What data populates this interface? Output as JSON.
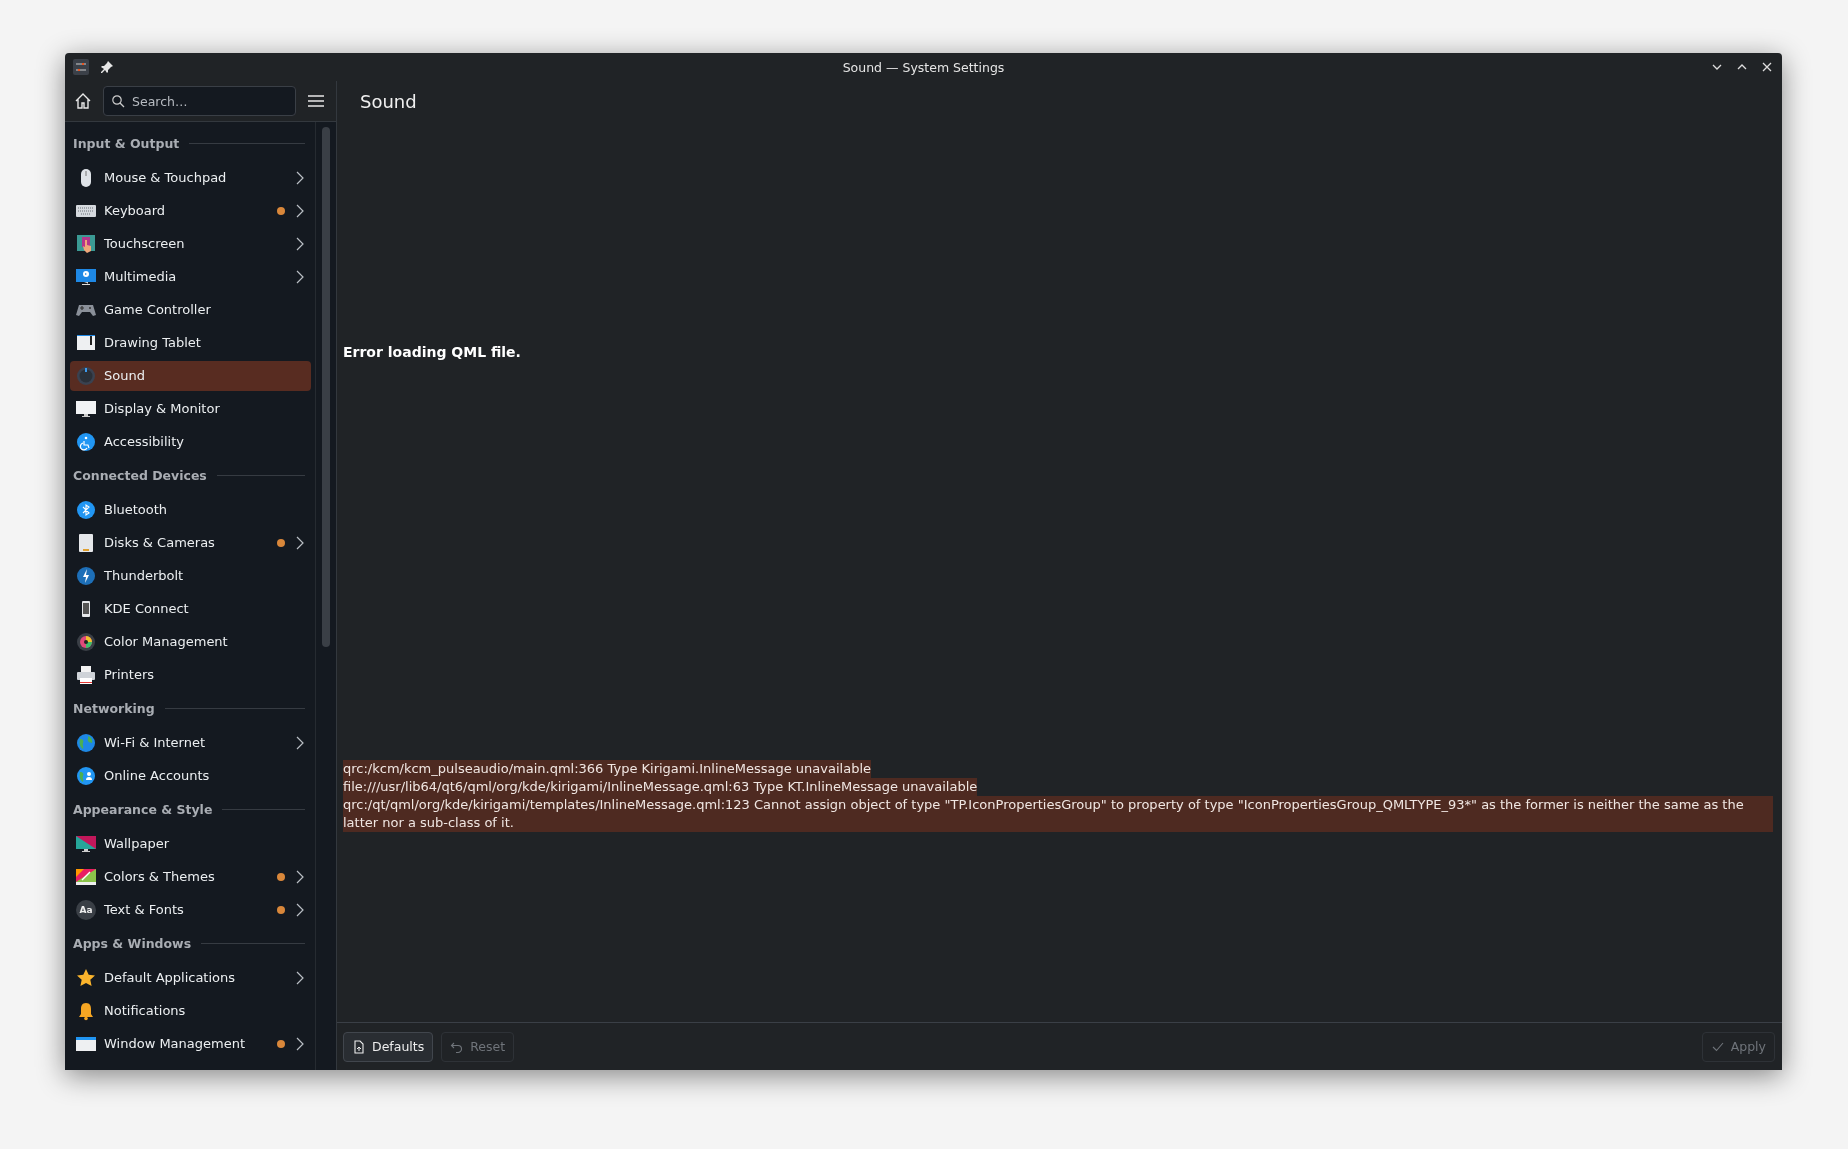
{
  "window": {
    "title": "Sound — System Settings"
  },
  "search": {
    "placeholder": "Search…"
  },
  "sidebar": {
    "sections": [
      {
        "title": "Input & Output",
        "items": [
          {
            "label": "Mouse & Touchpad",
            "modified": false,
            "has_children": true,
            "selected": false
          },
          {
            "label": "Keyboard",
            "modified": true,
            "has_children": true,
            "selected": false
          },
          {
            "label": "Touchscreen",
            "modified": false,
            "has_children": true,
            "selected": false
          },
          {
            "label": "Multimedia",
            "modified": false,
            "has_children": true,
            "selected": false
          },
          {
            "label": "Game Controller",
            "modified": false,
            "has_children": false,
            "selected": false
          },
          {
            "label": "Drawing Tablet",
            "modified": false,
            "has_children": false,
            "selected": false
          },
          {
            "label": "Sound",
            "modified": false,
            "has_children": false,
            "selected": true
          },
          {
            "label": "Display & Monitor",
            "modified": false,
            "has_children": false,
            "selected": false
          },
          {
            "label": "Accessibility",
            "modified": false,
            "has_children": false,
            "selected": false
          }
        ]
      },
      {
        "title": "Connected Devices",
        "items": [
          {
            "label": "Bluetooth",
            "modified": false,
            "has_children": false,
            "selected": false
          },
          {
            "label": "Disks & Cameras",
            "modified": true,
            "has_children": true,
            "selected": false
          },
          {
            "label": "Thunderbolt",
            "modified": false,
            "has_children": false,
            "selected": false
          },
          {
            "label": "KDE Connect",
            "modified": false,
            "has_children": false,
            "selected": false
          },
          {
            "label": "Color Management",
            "modified": false,
            "has_children": false,
            "selected": false
          },
          {
            "label": "Printers",
            "modified": false,
            "has_children": false,
            "selected": false
          }
        ]
      },
      {
        "title": "Networking",
        "items": [
          {
            "label": "Wi-Fi & Internet",
            "modified": false,
            "has_children": true,
            "selected": false
          },
          {
            "label": "Online Accounts",
            "modified": false,
            "has_children": false,
            "selected": false
          }
        ]
      },
      {
        "title": "Appearance & Style",
        "items": [
          {
            "label": "Wallpaper",
            "modified": false,
            "has_children": false,
            "selected": false
          },
          {
            "label": "Colors & Themes",
            "modified": true,
            "has_children": true,
            "selected": false
          },
          {
            "label": "Text & Fonts",
            "icon_text": "Aa",
            "modified": true,
            "has_children": true,
            "selected": false
          }
        ]
      },
      {
        "title": "Apps & Windows",
        "items": [
          {
            "label": "Default Applications",
            "modified": false,
            "has_children": true,
            "selected": false
          },
          {
            "label": "Notifications",
            "modified": false,
            "has_children": false,
            "selected": false
          },
          {
            "label": "Window Management",
            "modified": true,
            "has_children": true,
            "selected": false
          }
        ]
      }
    ]
  },
  "page": {
    "title": "Sound",
    "error_heading": "Error loading QML file.",
    "error_lines": [
      "qrc:/kcm/kcm_pulseaudio/main.qml:366 Type Kirigami.InlineMessage unavailable",
      "file:///usr/lib64/qt6/qml/org/kde/kirigami/InlineMessage.qml:63 Type KT.InlineMessage unavailable",
      "qrc:/qt/qml/org/kde/kirigami/templates/InlineMessage.qml:123 Cannot assign object of type \"TP.IconPropertiesGroup\" to property of type \"IconPropertiesGroup_QMLTYPE_93*\" as the former is neither the same as the latter nor a sub-class of it."
    ]
  },
  "footer": {
    "buttons": [
      {
        "label": "Defaults",
        "disabled": false
      },
      {
        "label": "Reset",
        "disabled": true
      }
    ],
    "apply": {
      "label": "Apply",
      "disabled": true
    }
  }
}
